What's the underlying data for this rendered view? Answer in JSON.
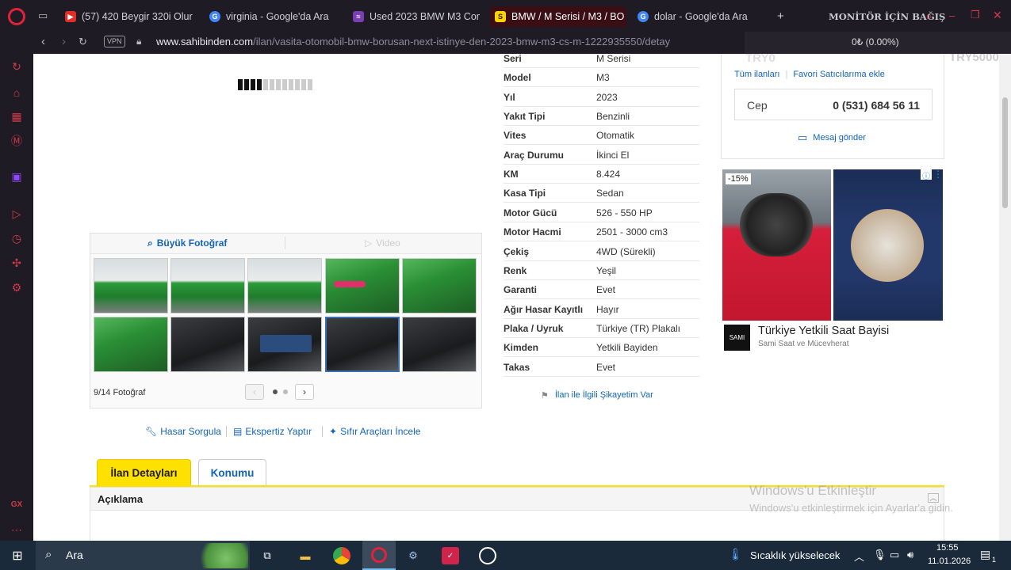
{
  "browser": {
    "tabs": [
      {
        "label": "(57) 420 Beygir 320i Olur",
        "favicon_color": "#e52d27",
        "favicon_text": "▶"
      },
      {
        "label": "virginia - Google'da Ara",
        "favicon_color": "#4285f4",
        "favicon_text": "G"
      },
      {
        "label": "Used 2023 BMW M3 Com",
        "favicon_color": "#7b3fb5",
        "favicon_text": "≈"
      },
      {
        "label": "BMW / M Serisi / M3 / BO",
        "favicon_color": "#ffd200",
        "favicon_text": "S"
      },
      {
        "label": "dolar - Google'da Ara",
        "favicon_color": "#4285f4",
        "favicon_text": "G"
      }
    ],
    "new_tab": "+",
    "monitor_label": "MONİTÖR İÇİN BAĞIŞ",
    "monitor_value": "0₺ (0.00%)",
    "url_host": "www.sahibinden.com",
    "url_path": "/ilan/vasita-otomobil-bmw-borusan-next-istinye-den-2023-bmw-m3-cs-m-1222935550/detay",
    "vpn_label": "VPN"
  },
  "gallery": {
    "big_photo_label": "Büyük Fotoğraf",
    "video_label": "Video",
    "counter": "9/14 Fotoğraf",
    "thumbs": [
      "car-green",
      "car-green",
      "car-green",
      "car-green2",
      "car-green2",
      "car-green2",
      "car-int",
      "car-int",
      "car-int",
      "car-int"
    ]
  },
  "actions": {
    "hasar": "Hasar Sorgula",
    "ekspertiz": "Ekspertiz Yaptır",
    "sifir": "Sıfır Araçları İncele"
  },
  "specs": [
    {
      "k": "Seri",
      "v": "M Serisi"
    },
    {
      "k": "Model",
      "v": "M3"
    },
    {
      "k": "Yıl",
      "v": "2023"
    },
    {
      "k": "Yakıt Tipi",
      "v": "Benzinli"
    },
    {
      "k": "Vites",
      "v": "Otomatik"
    },
    {
      "k": "Araç Durumu",
      "v": "İkinci El"
    },
    {
      "k": "KM",
      "v": "8.424"
    },
    {
      "k": "Kasa Tipi",
      "v": "Sedan"
    },
    {
      "k": "Motor Gücü",
      "v": "526 - 550 HP"
    },
    {
      "k": "Motor Hacmi",
      "v": "2501 - 3000 cm3"
    },
    {
      "k": "Çekiş",
      "v": "4WD (Sürekli)"
    },
    {
      "k": "Renk",
      "v": "Yeşil"
    },
    {
      "k": "Garanti",
      "v": "Evet"
    },
    {
      "k": "Ağır Hasar Kayıtlı",
      "v": "Hayır"
    },
    {
      "k": "Plaka / Uyruk",
      "v": "Türkiye (TR) Plakalı"
    },
    {
      "k": "Kimden",
      "v": "Yetkili Bayiden"
    },
    {
      "k": "Takas",
      "v": "Evet"
    }
  ],
  "complaint": "İlan ile İlgili Şikayetim Var",
  "seller": {
    "tum_ilanlari": "Tüm ilanları",
    "favori": "Favori Satıcılarıma ekle",
    "phone_label": "Cep",
    "phone": "0 (531) 684 56 11",
    "message": "Mesaj gönder",
    "try0": "TRY0",
    "try5000": "TRY5000"
  },
  "ad": {
    "discount": "-15%",
    "title": "Türkiye Yetkili Saat Bayisi",
    "subtitle": "Sami Saat ve Mücevherat",
    "logo": "SAMI"
  },
  "detail_tabs": {
    "ilan": "İlan Detayları",
    "konum": "Konumu",
    "aciklama": "Açıklama"
  },
  "watermark": {
    "line1": "Windows'u Etkinleştir",
    "line2": "Windows'u etkinleştirmek için Ayarlar'a gidin."
  },
  "taskbar": {
    "search": "Ara",
    "weather": "Sıcaklık yükselecek",
    "time": "15:55",
    "date": "11.01.2026",
    "notif": "1"
  }
}
